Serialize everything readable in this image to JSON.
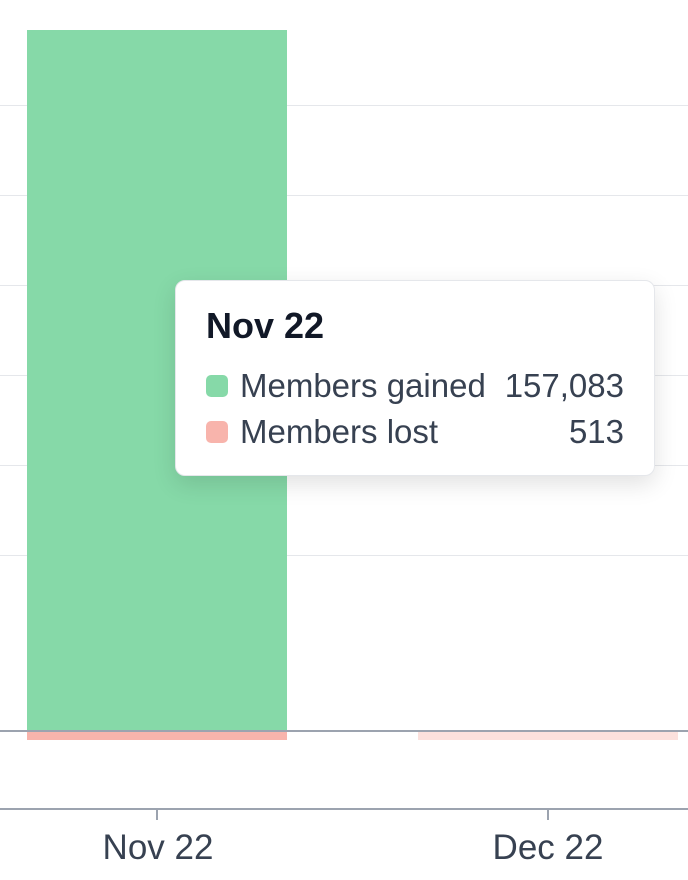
{
  "chart_data": {
    "type": "bar",
    "categories": [
      "Nov 22",
      "Dec 22"
    ],
    "series": [
      {
        "name": "Members gained",
        "values": [
          157083,
          null
        ],
        "color": "#86d9a8"
      },
      {
        "name": "Members lost",
        "values": [
          513,
          null
        ],
        "color": "#f8b4ac"
      }
    ],
    "xlabel": "",
    "ylabel": ""
  },
  "tooltip": {
    "title": "Nov 22",
    "rows": [
      {
        "label": "Members gained",
        "value": "157,083"
      },
      {
        "label": "Members lost",
        "value": "513"
      }
    ]
  },
  "xaxis": {
    "labels": [
      "Nov 22",
      "Dec 22"
    ]
  }
}
